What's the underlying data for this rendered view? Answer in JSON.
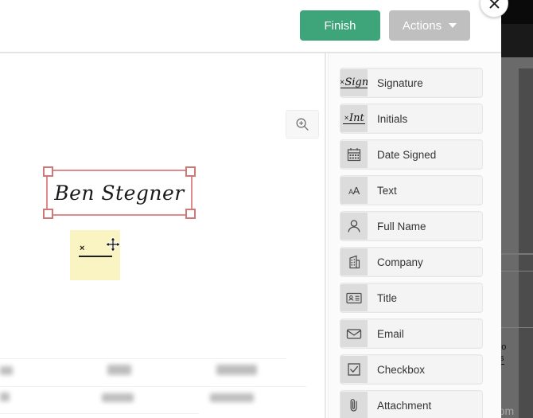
{
  "header": {
    "finish_label": "Finish",
    "actions_label": "Actions",
    "close_icon": "close-icon",
    "caret_icon": "chevron-down-icon"
  },
  "toolbar": {
    "zoom_in_icon": "zoom-in-icon"
  },
  "document": {
    "placed_signature": {
      "value": "Ben Stegner",
      "state": "selected"
    },
    "pending_signature": {
      "marker": "×",
      "cursor_icon": "move-cursor-icon"
    }
  },
  "field_palette": {
    "items": [
      {
        "label": "Signature",
        "icon": "signature-icon"
      },
      {
        "label": "Initials",
        "icon": "initials-icon"
      },
      {
        "label": "Date Signed",
        "icon": "calendar-icon"
      },
      {
        "label": "Text",
        "icon": "text-icon"
      },
      {
        "label": "Full Name",
        "icon": "person-icon"
      },
      {
        "label": "Company",
        "icon": "building-icon"
      },
      {
        "label": "Title",
        "icon": "id-card-icon"
      },
      {
        "label": "Email",
        "icon": "envelope-icon"
      },
      {
        "label": "Checkbox",
        "icon": "checkbox-icon"
      },
      {
        "label": "Attachment",
        "icon": "paperclip-icon"
      }
    ]
  },
  "background": {
    "time_text": "ago",
    "details_link": "tails",
    "domain_text": "n.com"
  },
  "colors": {
    "finish_green": "#3ea57a",
    "actions_gray": "#bfbfbf",
    "selection_red": "#e08b8b",
    "note_yellow": "#faf4c3",
    "panel_bg": "#fbfbfb"
  }
}
